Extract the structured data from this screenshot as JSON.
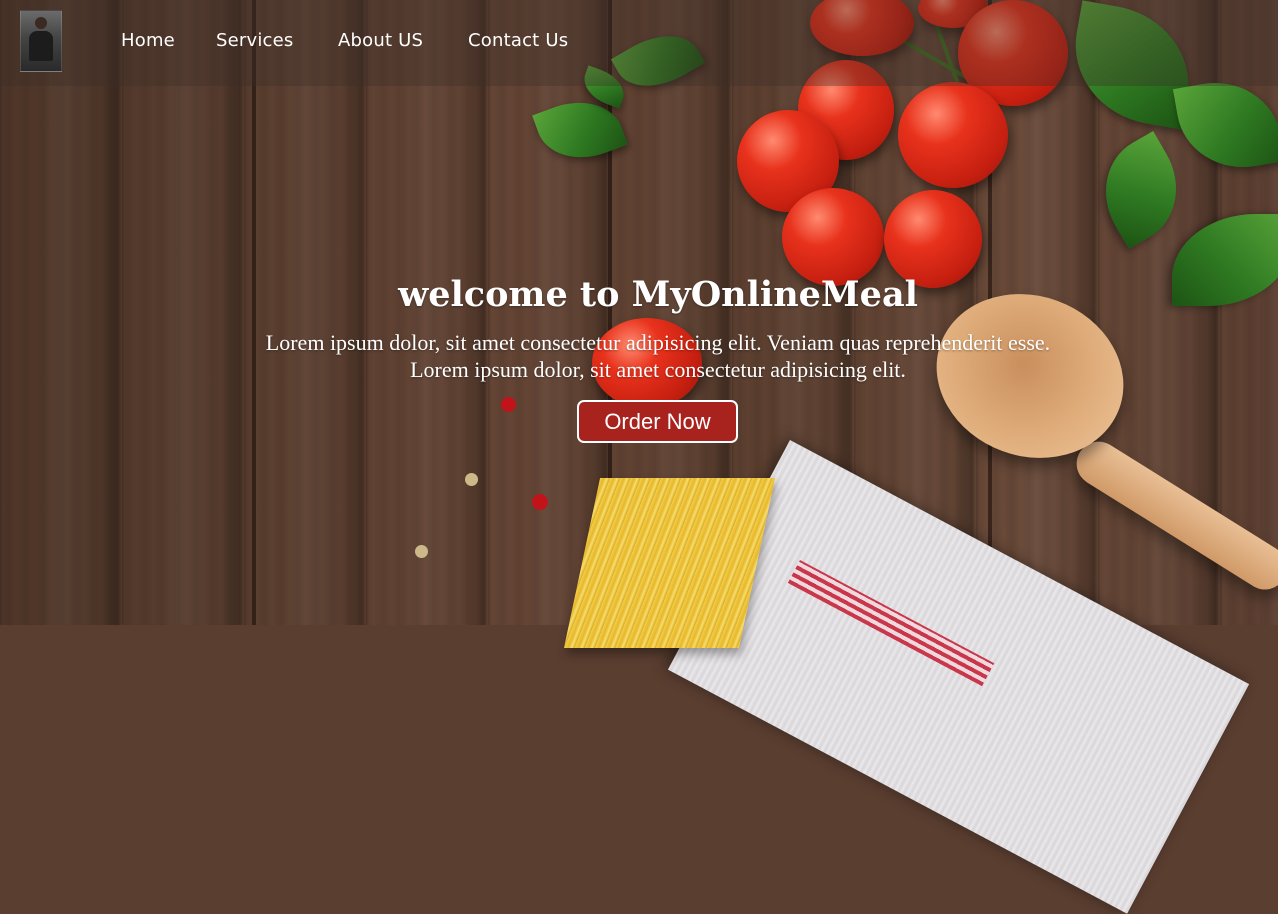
{
  "nav": {
    "items": [
      {
        "label": "Home"
      },
      {
        "label": "Services"
      },
      {
        "label": "About US"
      },
      {
        "label": "Contact Us"
      }
    ]
  },
  "hero": {
    "title": "welcome to MyOnlineMeal",
    "line1": "Lorem ipsum dolor, sit amet consectetur adipisicing elit. Veniam quas reprehenderit esse.",
    "line2": "Lorem ipsum dolor, sit amet consectetur adipisicing elit.",
    "cta_label": "Order Now"
  },
  "colors": {
    "cta_background": "#a8221e",
    "text": "#ffffff",
    "wood": "#5b3f30"
  }
}
